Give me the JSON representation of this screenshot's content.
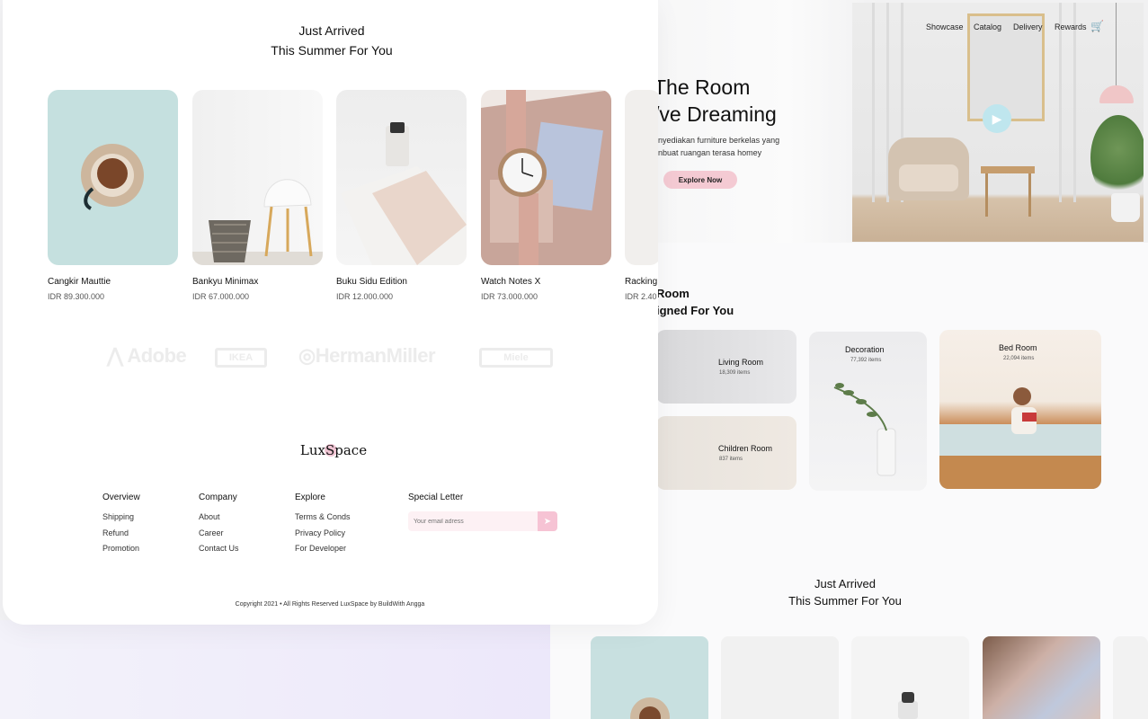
{
  "hero": {
    "title_line1": "The Room",
    "title_line2": "/ve Dreaming",
    "subtitle_line1": "nyediakan furniture berkelas yang",
    "subtitle_line2": "nbuat ruangan terasa homey",
    "cta_label": "Explore Now"
  },
  "nav": {
    "items": [
      "Showcase",
      "Catalog",
      "Delivery",
      "Rewards"
    ],
    "active": "Catalog"
  },
  "rooms": {
    "title_line1": "Room",
    "title_line2": "igned For You",
    "items": [
      {
        "name": "Living Room",
        "count": "18,309 items"
      },
      {
        "name": "Decoration",
        "count": "77,392 items"
      },
      {
        "name": "Bed Room",
        "count": "22,094 items"
      },
      {
        "name": "Children Room",
        "count": "837 items"
      }
    ]
  },
  "arrived": {
    "title_line1": "Just Arrived",
    "title_line2": "This Summer For You",
    "products": [
      {
        "name": "Cangkir Mauttie",
        "price": "IDR 89.300.000"
      },
      {
        "name": "Bankyu Minimax",
        "price": "IDR 67.000.000"
      },
      {
        "name": "Buku Sidu Edition",
        "price": "IDR 12.000.000"
      },
      {
        "name": "Watch Notes X",
        "price": "IDR 73.000.000"
      },
      {
        "name": "Racking",
        "price": "IDR 2.40"
      }
    ]
  },
  "arrived_bg": {
    "title_line1": "Just Arrived",
    "title_line2": "This Summer For You"
  },
  "brands": [
    "Adobe",
    "IKEA",
    "HermanMiller",
    "Miele"
  ],
  "footer": {
    "logo": "LuxSpace",
    "columns": [
      {
        "title": "Overview",
        "links": [
          "Shipping",
          "Refund",
          "Promotion"
        ]
      },
      {
        "title": "Company",
        "links": [
          "About",
          "Career",
          "Contact Us"
        ]
      },
      {
        "title": "Explore",
        "links": [
          "Terms & Conds",
          "Privacy Policy",
          "For Developer"
        ]
      }
    ],
    "newsletter": {
      "title": "Special Letter",
      "placeholder": "Your email adress"
    },
    "copyright": "Copyright 2021 • All Rights Reserved LuxSpace by BuildWith Angga"
  },
  "colors": {
    "accent_pink": "#f4cad3",
    "play_button": "#bfe6ee",
    "frame_gold": "#d9bf8c"
  },
  "icons": {
    "cart": "cart-icon",
    "play": "play-icon",
    "send": "send-icon"
  }
}
